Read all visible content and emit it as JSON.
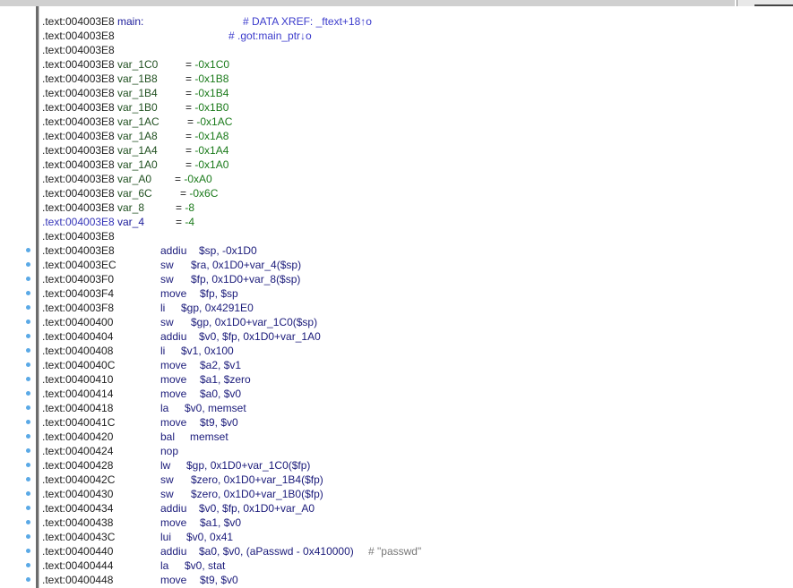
{
  "theme": {
    "address_color": "#202020",
    "mnemonic_color": "#1a1a7a",
    "number_color": "#1a7a1a",
    "comment_color": "#3c3ccc",
    "breakpoint_dot_color": "#5aa9e6"
  },
  "listing": {
    "header": [
      {
        "addr": ".text:004003E8",
        "symbol": "main:",
        "comment": "# DATA XREF: _ftext+18",
        "comment_tail": "o",
        "arrow": "↑"
      },
      {
        "addr": ".text:004003E8",
        "comment": "# .got:main_ptr",
        "comment_tail": "o",
        "arrow": "↓"
      },
      {
        "addr": ".text:004003E8"
      }
    ],
    "vars": [
      {
        "addr": ".text:004003E8",
        "name": "var_1C0",
        "value": "-0x1C0"
      },
      {
        "addr": ".text:004003E8",
        "name": "var_1B8",
        "value": "-0x1B8"
      },
      {
        "addr": ".text:004003E8",
        "name": "var_1B4",
        "value": "-0x1B4"
      },
      {
        "addr": ".text:004003E8",
        "name": "var_1B0",
        "value": "-0x1B0"
      },
      {
        "addr": ".text:004003E8",
        "name": "var_1AC",
        "value": "-0x1AC"
      },
      {
        "addr": ".text:004003E8",
        "name": "var_1A8",
        "value": "-0x1A8"
      },
      {
        "addr": ".text:004003E8",
        "name": "var_1A4",
        "value": "-0x1A4"
      },
      {
        "addr": ".text:004003E8",
        "name": "var_1A0",
        "value": "-0x1A0"
      },
      {
        "addr": ".text:004003E8",
        "name": "var_A0",
        "value": "-0xA0"
      },
      {
        "addr": ".text:004003E8",
        "name": "var_6C",
        "value": "-0x6C"
      },
      {
        "addr": ".text:004003E8",
        "name": "var_8",
        "value": "-8"
      },
      {
        "addr": ".text:004003E8",
        "name": "var_4",
        "value": "-4",
        "highlight": true
      }
    ],
    "blank_after_vars": ".text:004003E8",
    "instructions": [
      {
        "addr": ".text:004003E8",
        "mnemonic": "addiu",
        "operands": "$sp, -0x1D0"
      },
      {
        "addr": ".text:004003EC",
        "mnemonic": "sw",
        "operands": "$ra, 0x1D0+var_4($sp)"
      },
      {
        "addr": ".text:004003F0",
        "mnemonic": "sw",
        "operands": "$fp, 0x1D0+var_8($sp)"
      },
      {
        "addr": ".text:004003F4",
        "mnemonic": "move",
        "operands": "$fp, $sp"
      },
      {
        "addr": ".text:004003F8",
        "mnemonic": "li",
        "operands": "$gp, 0x4291E0"
      },
      {
        "addr": ".text:00400400",
        "mnemonic": "sw",
        "operands": "$gp, 0x1D0+var_1C0($sp)"
      },
      {
        "addr": ".text:00400404",
        "mnemonic": "addiu",
        "operands": "$v0, $fp, 0x1D0+var_1A0"
      },
      {
        "addr": ".text:00400408",
        "mnemonic": "li",
        "operands": "$v1, 0x100"
      },
      {
        "addr": ".text:0040040C",
        "mnemonic": "move",
        "operands": "$a2, $v1"
      },
      {
        "addr": ".text:00400410",
        "mnemonic": "move",
        "operands": "$a1, $zero"
      },
      {
        "addr": ".text:00400414",
        "mnemonic": "move",
        "operands": "$a0, $v0"
      },
      {
        "addr": ".text:00400418",
        "mnemonic": "la",
        "operands": "$v0, memset"
      },
      {
        "addr": ".text:0040041C",
        "mnemonic": "move",
        "operands": "$t9, $v0"
      },
      {
        "addr": ".text:00400420",
        "mnemonic": "bal",
        "operands": "memset"
      },
      {
        "addr": ".text:00400424",
        "mnemonic": "nop",
        "operands": ""
      },
      {
        "addr": ".text:00400428",
        "mnemonic": "lw",
        "operands": "$gp, 0x1D0+var_1C0($fp)"
      },
      {
        "addr": ".text:0040042C",
        "mnemonic": "sw",
        "operands": "$zero, 0x1D0+var_1B4($fp)"
      },
      {
        "addr": ".text:00400430",
        "mnemonic": "sw",
        "operands": "$zero, 0x1D0+var_1B0($fp)"
      },
      {
        "addr": ".text:00400434",
        "mnemonic": "addiu",
        "operands": "$v0, $fp, 0x1D0+var_A0"
      },
      {
        "addr": ".text:00400438",
        "mnemonic": "move",
        "operands": "$a1, $v0"
      },
      {
        "addr": ".text:0040043C",
        "mnemonic": "lui",
        "operands": "$v0, 0x41"
      },
      {
        "addr": ".text:00400440",
        "mnemonic": "addiu",
        "operands": "$a0, $v0, (aPasswd - 0x410000)",
        "comment": "# \"passwd\""
      },
      {
        "addr": ".text:00400444",
        "mnemonic": "la",
        "operands": "$v0, stat"
      },
      {
        "addr": ".text:00400448",
        "mnemonic": "move",
        "operands": "$t9, $v0"
      }
    ]
  }
}
